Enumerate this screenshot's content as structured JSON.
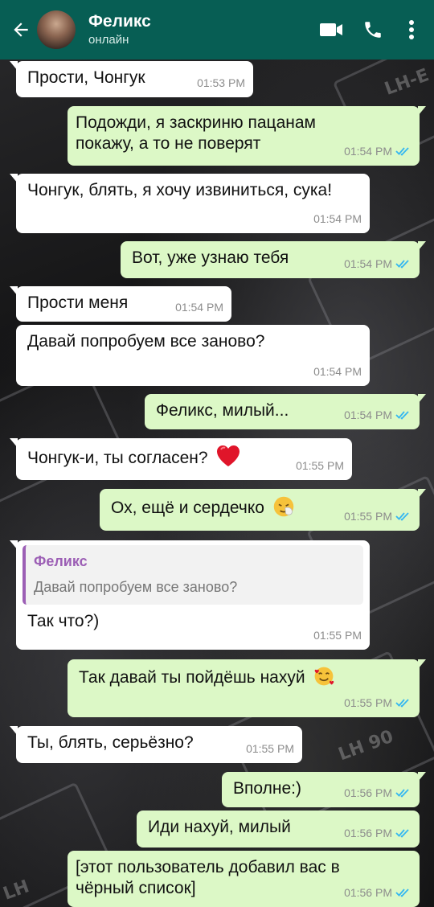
{
  "header": {
    "title": "Феликс",
    "status": "онлайн"
  },
  "colors": {
    "header_bg": "#075e54",
    "incoming_bubble": "#ffffff",
    "outgoing_bubble": "#dcf8c6",
    "read_ticks": "#34b7f1",
    "quote_accent": "#9c5fb5"
  },
  "background_labels": [
    "LH-E",
    "LH 90",
    "LH"
  ],
  "messages": [
    {
      "dir": "in",
      "text": "Прости, Чонгук",
      "time": "01:53 PM"
    },
    {
      "dir": "out",
      "text": "Подожди, я заскриню пацанам покажу, а то не поверят",
      "time": "01:54 PM",
      "ticks": "read"
    },
    {
      "dir": "in",
      "text": "Чонгук, блять, я хочу извиниться, сука!",
      "time": "01:54 PM"
    },
    {
      "dir": "out",
      "text": "Вот, уже узнаю тебя",
      "time": "01:54 PM",
      "ticks": "read"
    },
    {
      "dir": "in",
      "text": "Прости меня",
      "time": "01:54 PM"
    },
    {
      "dir": "in",
      "text": "Давай попробуем все заново?",
      "time": "01:54 PM"
    },
    {
      "dir": "out",
      "text": "Феликс, милый...",
      "time": "01:54 PM",
      "ticks": "read"
    },
    {
      "dir": "in",
      "text": "Чонгук-и, ты согласен?",
      "emoji": "red-heart",
      "time": "01:55 PM"
    },
    {
      "dir": "out",
      "text": "Ох, ещё и сердечко",
      "emoji": "sneezing-face",
      "time": "01:55 PM",
      "ticks": "read"
    },
    {
      "dir": "in",
      "quote": {
        "name": "Феликс",
        "text": "Давай попробуем все заново?"
      },
      "text": "Так что?)",
      "time": "01:55 PM"
    },
    {
      "dir": "out",
      "text": "Так давай ты пойдёшь нахуй",
      "emoji": "smiling-face-with-hearts",
      "time": "01:55 PM",
      "ticks": "read"
    },
    {
      "dir": "in",
      "text": "Ты, блять, серьёзно?",
      "time": "01:55 PM"
    },
    {
      "dir": "out",
      "text": "Вполне:)",
      "time": "01:56 PM",
      "ticks": "read"
    },
    {
      "dir": "out",
      "text": "Иди нахуй, милый",
      "time": "01:56 PM",
      "ticks": "read"
    },
    {
      "dir": "out",
      "text": "[этот пользователь добавил вас в чёрный список]",
      "time": "01:56 PM",
      "ticks": "read"
    }
  ]
}
